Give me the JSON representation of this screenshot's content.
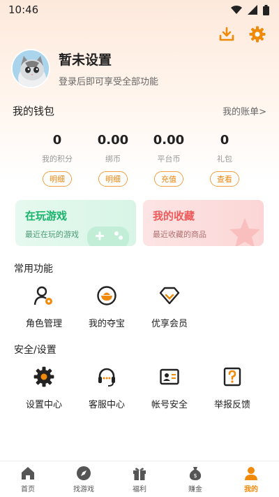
{
  "status_bar": {
    "time": "10:46"
  },
  "header": {
    "download_icon": "download-icon",
    "settings_icon": "gear-icon"
  },
  "profile": {
    "name": "暂未设置",
    "subtitle": "登录后即可享受全部功能"
  },
  "wallet": {
    "title": "我的钱包",
    "bill_link": "我的账单>",
    "stats": [
      {
        "value": "0",
        "label": "我的积分",
        "button": "明细"
      },
      {
        "value": "0.00",
        "label": "绑币",
        "button": "明细"
      },
      {
        "value": "0.00",
        "label": "平台币",
        "button": "充值"
      },
      {
        "value": "0",
        "label": "礼包",
        "button": "查看"
      }
    ]
  },
  "cards": {
    "playing": {
      "title": "在玩游戏",
      "subtitle": "最近在玩的游戏"
    },
    "favorites": {
      "title": "我的收藏",
      "subtitle": "最近收藏的商品"
    }
  },
  "common": {
    "title": "常用功能",
    "items": [
      {
        "label": "角色管理",
        "icon": "role-manage-icon"
      },
      {
        "label": "我的夺宝",
        "icon": "treasure-icon"
      },
      {
        "label": "优享会员",
        "icon": "diamond-icon"
      }
    ]
  },
  "security": {
    "title": "安全/设置",
    "items": [
      {
        "label": "设置中心",
        "icon": "gear-icon"
      },
      {
        "label": "客服中心",
        "icon": "headset-icon"
      },
      {
        "label": "帐号安全",
        "icon": "id-card-icon"
      },
      {
        "label": "举报反馈",
        "icon": "question-icon"
      }
    ]
  },
  "nav": [
    {
      "label": "首页",
      "icon": "home-icon"
    },
    {
      "label": "找游戏",
      "icon": "compass-icon"
    },
    {
      "label": "福利",
      "icon": "gift-icon"
    },
    {
      "label": "赚金",
      "icon": "money-bag-icon"
    },
    {
      "label": "我的",
      "icon": "user-icon",
      "active": true
    }
  ],
  "colors": {
    "accent": "#f08a0a",
    "green": "#18b36a",
    "red": "#f05a5a"
  }
}
